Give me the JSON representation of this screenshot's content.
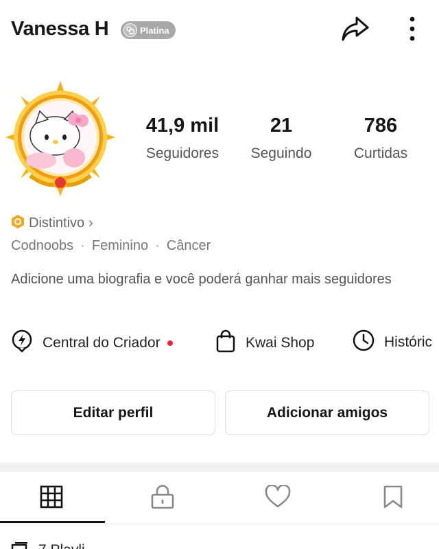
{
  "profile": {
    "name": "Vanessa H",
    "badge_label": "Platina"
  },
  "icons": {
    "share": "share-arrow-icon",
    "more": "more-vertical-icon",
    "distintivo": "badge-icon",
    "creator": "lightning-icon",
    "shop": "shopping-bag-icon",
    "history": "clock-icon",
    "grid": "grid-icon",
    "lock": "lock-icon",
    "heart": "heart-icon",
    "bookmark": "bookmark-icon"
  },
  "stats": [
    {
      "value": "41,9 mil",
      "label": "Seguidores"
    },
    {
      "value": "21",
      "label": "Seguindo"
    },
    {
      "value": "786",
      "label": "Curtidas"
    }
  ],
  "distintivo": {
    "label": "Distintivo",
    "chevron": "›"
  },
  "tags": [
    "Codnoobs",
    "·",
    "Feminino",
    "·",
    "Câncer"
  ],
  "bio": "Adicione uma biografia e você poderá ganhar mais seguidores",
  "quick_actions": [
    {
      "label": "Central do Criador",
      "has_dot": true
    },
    {
      "label": "Kwai Shop"
    },
    {
      "label": "Históric"
    }
  ],
  "buttons": {
    "edit": "Editar perfil",
    "add_friends": "Adicionar amigos"
  },
  "tabs": [
    "grid",
    "lock",
    "heart",
    "bookmark"
  ],
  "bottom": {
    "label": "7 Playli"
  },
  "colors": {
    "accent_dot": "#ff1f3d",
    "badge_bg": "#a8a8a8",
    "distintivo_icon": "#f5a623",
    "avatar_ring": "#f7b21a"
  }
}
